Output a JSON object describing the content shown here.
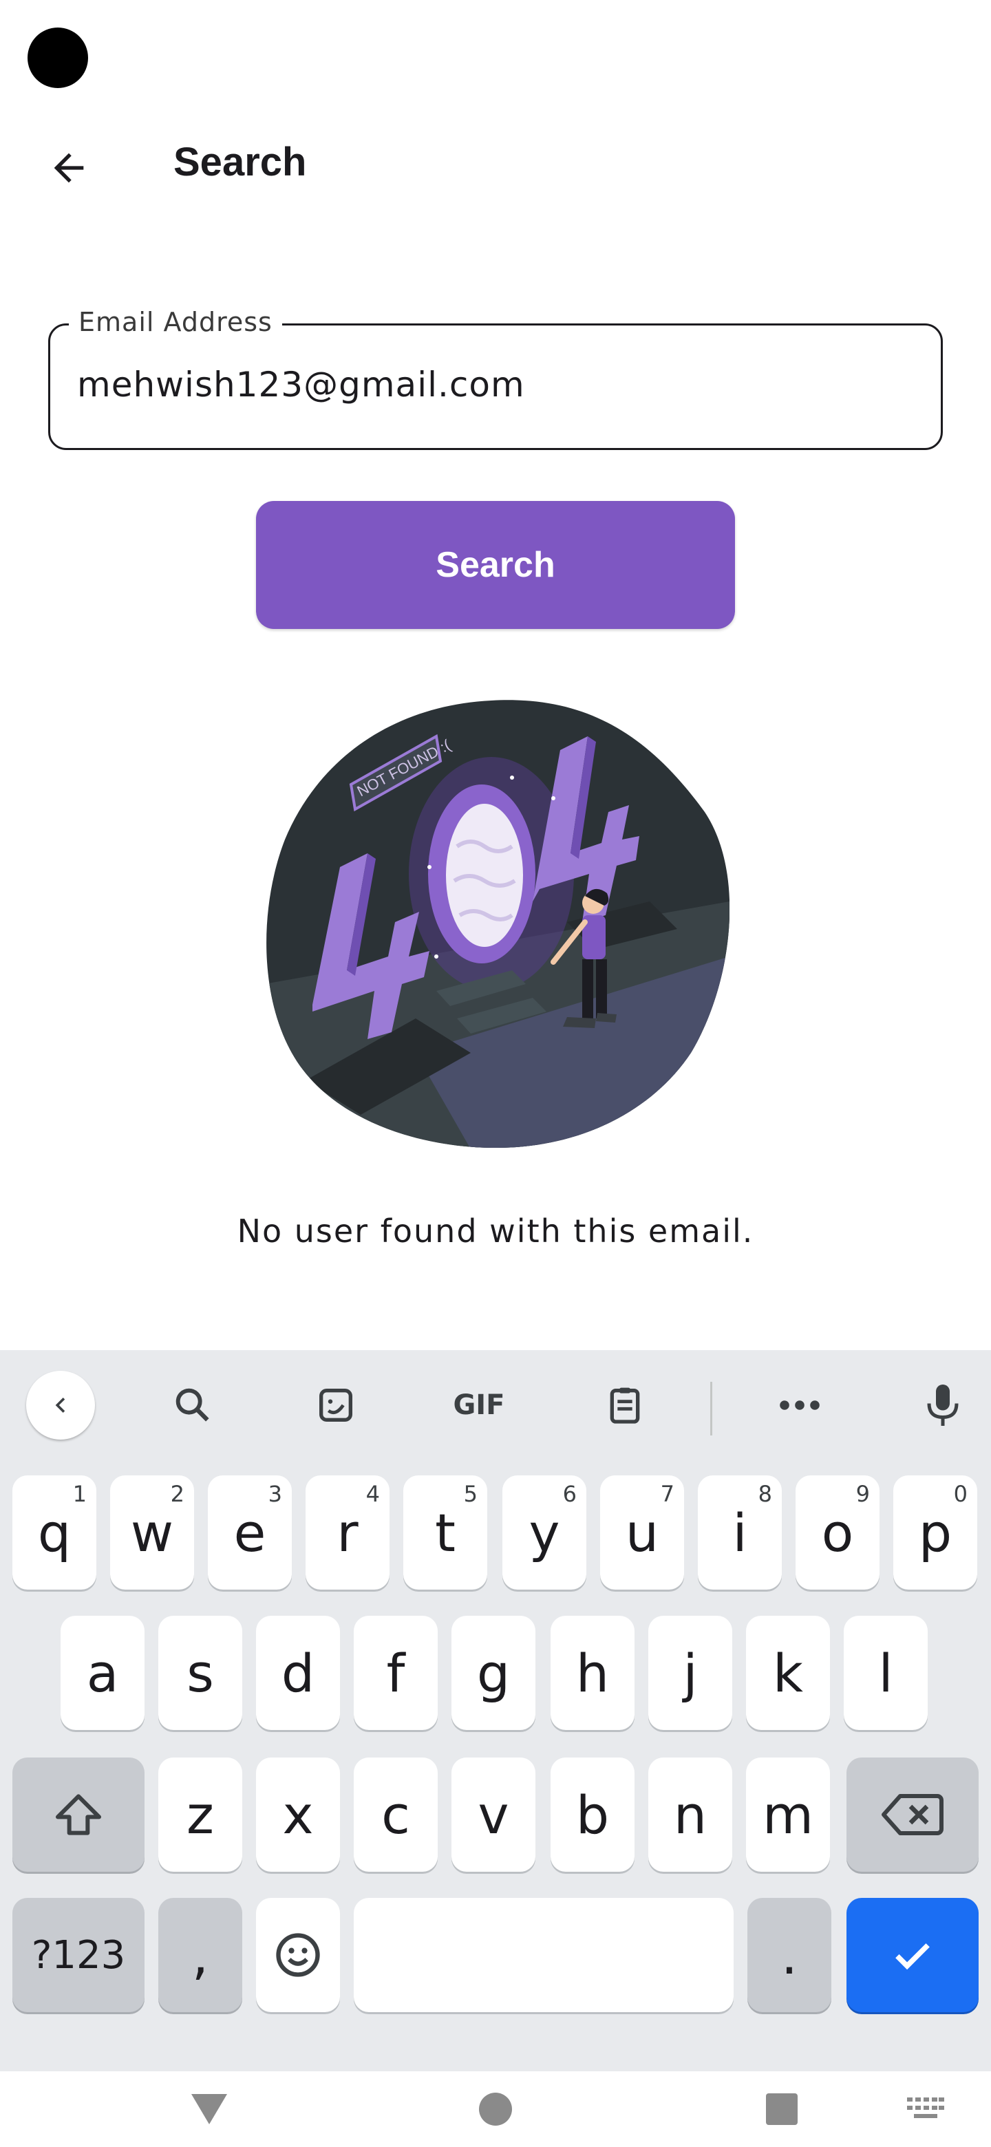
{
  "header": {
    "title": "Search",
    "back_icon": "arrow-left-icon"
  },
  "form": {
    "email_label": "Email Address",
    "email_value": "mehwish123@gmail.com",
    "search_button": "Search"
  },
  "illustration": {
    "sign_text": "NOT FOUND :(",
    "number_text": "404"
  },
  "result": {
    "message": "No user found with this email."
  },
  "keyboard": {
    "toolbar": [
      "chevron-left-icon",
      "search-icon",
      "sticker-icon",
      "GIF",
      "clipboard-icon",
      "more-icon",
      "mic-icon"
    ],
    "gif_label": "GIF",
    "row1": [
      {
        "k": "q",
        "h": "1"
      },
      {
        "k": "w",
        "h": "2"
      },
      {
        "k": "e",
        "h": "3"
      },
      {
        "k": "r",
        "h": "4"
      },
      {
        "k": "t",
        "h": "5"
      },
      {
        "k": "y",
        "h": "6"
      },
      {
        "k": "u",
        "h": "7"
      },
      {
        "k": "i",
        "h": "8"
      },
      {
        "k": "o",
        "h": "9"
      },
      {
        "k": "p",
        "h": "0"
      }
    ],
    "row2": [
      "a",
      "s",
      "d",
      "f",
      "g",
      "h",
      "j",
      "k",
      "l"
    ],
    "row3": [
      "z",
      "x",
      "c",
      "v",
      "b",
      "n",
      "m"
    ],
    "symbols_label": "?123",
    "comma_label": ",",
    "period_label": ".",
    "accent_color": "#1b6ef3"
  },
  "colors": {
    "primary": "#7e57c2",
    "illustration_bg": "#2b3236"
  }
}
